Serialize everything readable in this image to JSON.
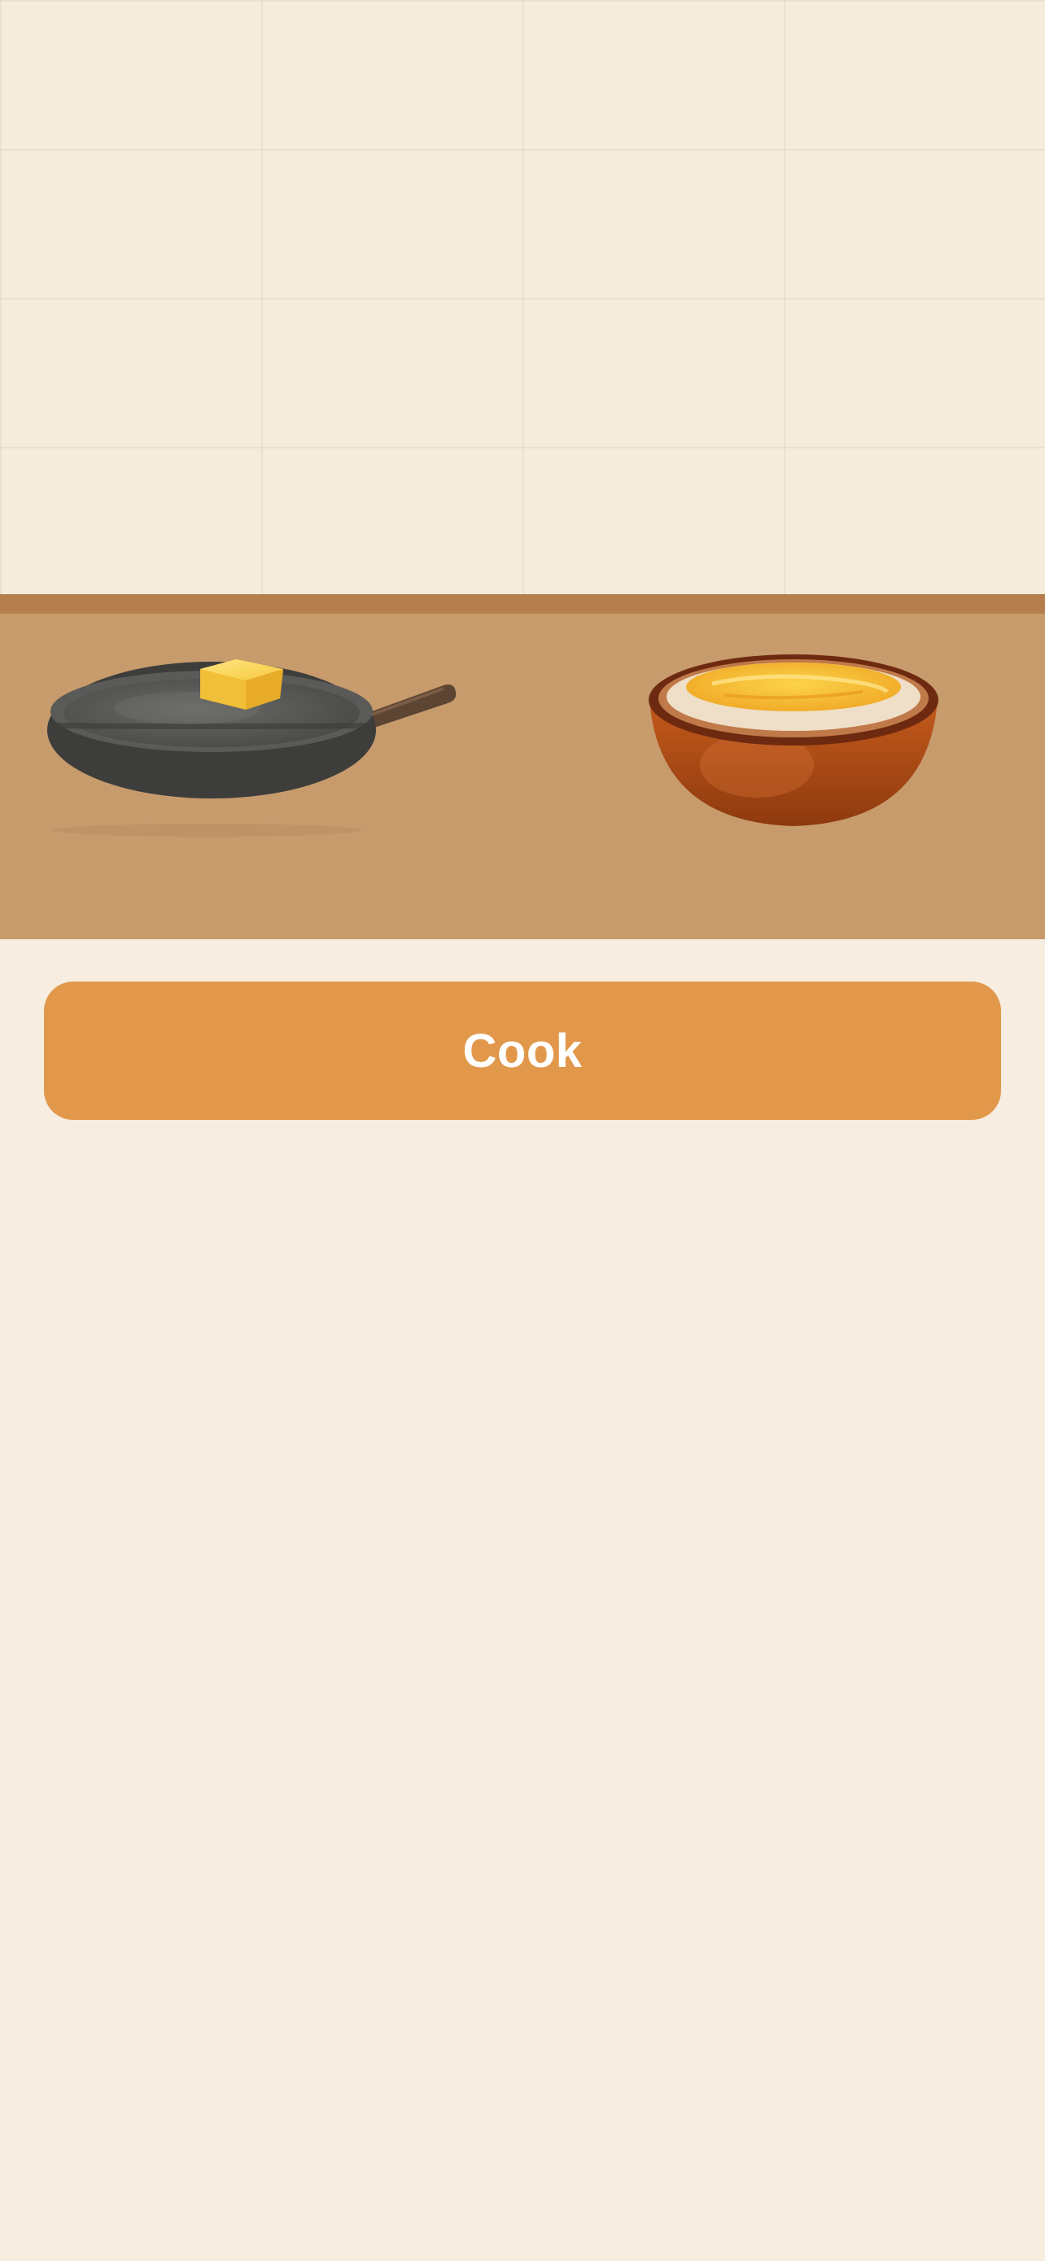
{
  "scene": {
    "items": [
      {
        "name": "frying-pan-with-butter",
        "icon": "frying-pan-butter-icon"
      },
      {
        "name": "bowl-of-beaten-eggs",
        "icon": "egg-bowl-icon"
      }
    ]
  },
  "actions": {
    "cook_label": "Cook"
  },
  "colors": {
    "background": "#f7ede0",
    "counter": "#c79b6c",
    "counter_edge": "#b47f4d",
    "button": "#e2984b",
    "button_text": "#ffffff"
  }
}
